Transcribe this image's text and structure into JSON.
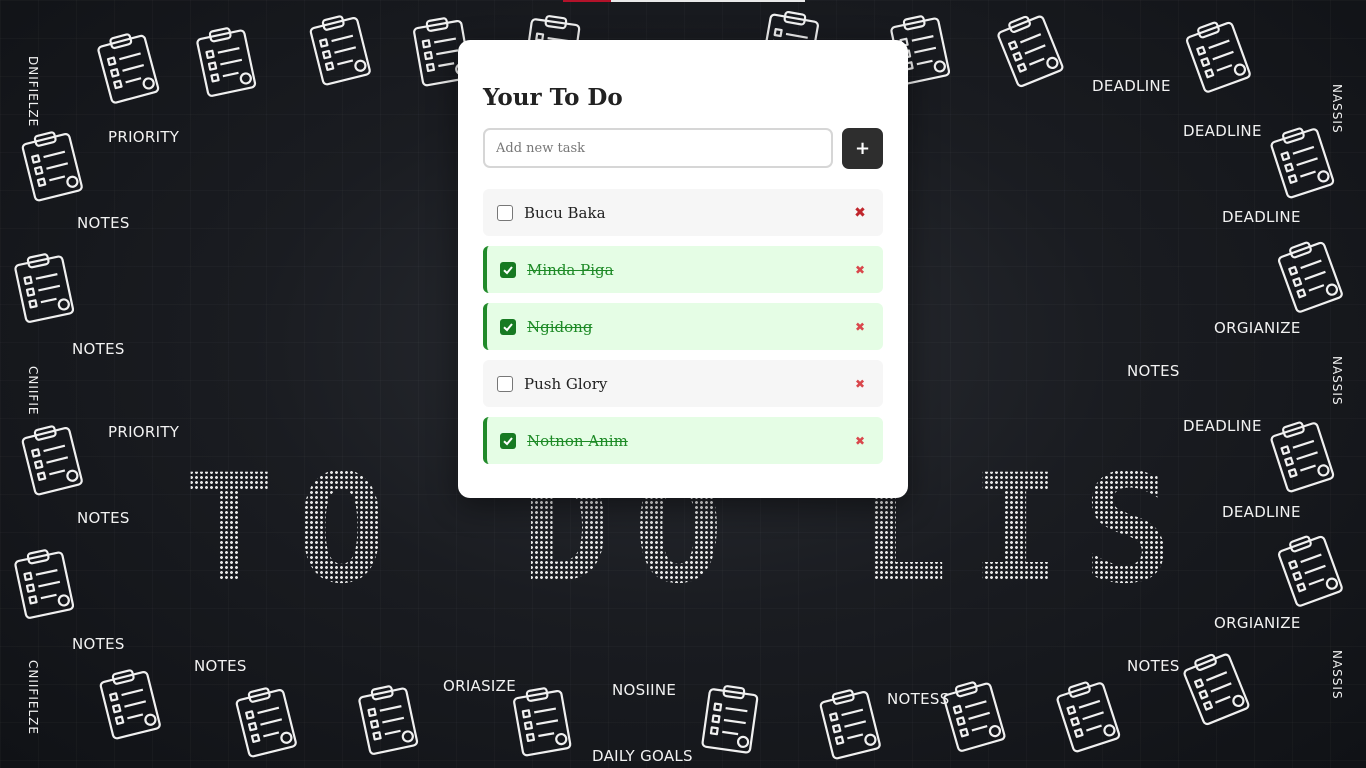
{
  "app": {
    "title": "Your To Do",
    "input_placeholder": "Add new task",
    "input_value": "",
    "add_button_icon": "plus-icon",
    "add_button_label": "+",
    "delete_icon": "close-icon",
    "delete_label": "✖"
  },
  "tasks": [
    {
      "text": "Bucu Baka",
      "done": false
    },
    {
      "text": "Minda Piga",
      "done": true
    },
    {
      "text": "Ngidong",
      "done": true
    },
    {
      "text": "Push Glory",
      "done": false
    },
    {
      "text": "Notnon Anim",
      "done": true
    }
  ],
  "background": {
    "headline": "TO DO LIST",
    "words": [
      "PRIORITY",
      "NOTES",
      "NOTES",
      "PRIORITY",
      "NOTES",
      "NOTES",
      "NOTES",
      "ORIASIZE",
      "NOSIINE",
      "DAILY GOALS",
      "NOTESS",
      "NOTES",
      "DEADLINE",
      "DEADLINE",
      "DEADLINE",
      "ORGIANIZE",
      "NOTES",
      "DEADLINE",
      "DEADLINE",
      "ORGIANIZE"
    ],
    "side_words": [
      "DNIFIELZE",
      "CNIIFIE",
      "CNIIFIELZE",
      "NASSIS",
      "NASSIS",
      "NASSIS"
    ]
  },
  "colors": {
    "done_accent": "#218a2a",
    "done_bg": "#e5fde5",
    "delete": "#c0262c",
    "button_bg": "#2e2e2e"
  }
}
